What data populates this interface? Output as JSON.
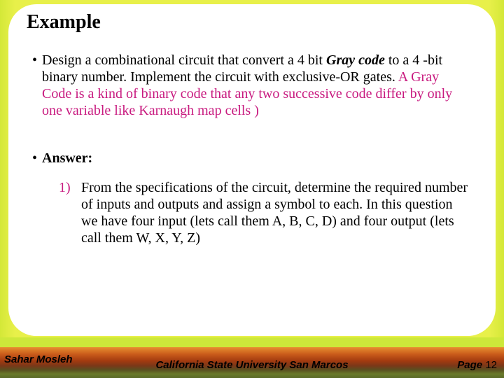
{
  "title": "Example",
  "bullet1": {
    "pre": "Design a combinational circuit that convert a 4 bit ",
    "em": "Gray code",
    "mid": " to a 4 -bit binary number. Implement the circuit with exclusive-OR gates. ",
    "mag": "A Gray Code is a kind of binary code that any two successive code differ by only one variable like Karnaugh map cells )"
  },
  "answer_label": "Answer:",
  "step1": {
    "num": "1)",
    "text": "From the specifications of the circuit, determine the required number of inputs and outputs and assign a symbol to each. In this question we have four input (lets call them A, B, C, D) and four output  (lets call them W, X, Y, Z)"
  },
  "footer": {
    "author": "Sahar Mosleh",
    "university": "California State University San Marcos",
    "page_label": "Page ",
    "page_num": "12"
  }
}
